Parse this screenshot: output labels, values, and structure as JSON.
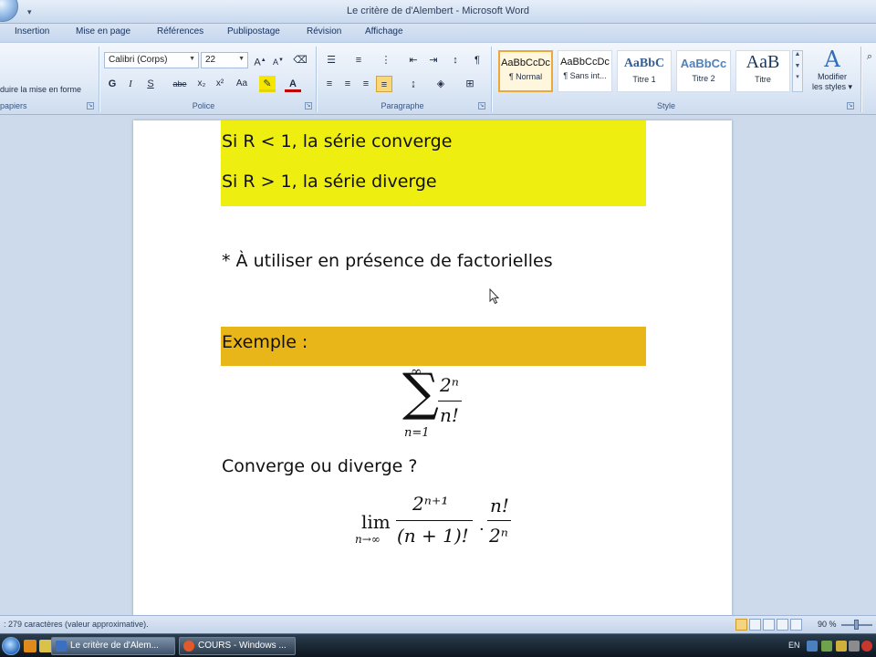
{
  "window": {
    "title": "Le critère de d'Alembert - Microsoft Word"
  },
  "tabs": [
    "Insertion",
    "Mise en page",
    "Références",
    "Publipostage",
    "Révision",
    "Affichage"
  ],
  "ribbon": {
    "clipboard": {
      "reproduce_format": "duire la mise en forme",
      "label": "papiers"
    },
    "font": {
      "name": "Calibri (Corps)",
      "size": "22",
      "label": "Police",
      "buttons": [
        "G",
        "I",
        "S",
        "abe",
        "x₂",
        "x²",
        "Aa"
      ]
    },
    "paragraph": {
      "label": "Paragraphe"
    },
    "styles": {
      "label": "Style",
      "items": [
        {
          "preview": "AaBbCcDc",
          "name": "¶ Normal"
        },
        {
          "preview": "AaBbCcDc",
          "name": "¶ Sans int..."
        },
        {
          "preview": "AaBbC",
          "name": "Titre 1"
        },
        {
          "preview": "AaBbCc",
          "name": "Titre 2"
        },
        {
          "preview": "AaB",
          "name": "Titre"
        }
      ],
      "modify_line1": "Modifier",
      "modify_line2": "les styles"
    }
  },
  "document": {
    "line1": "Si R < 1, la série converge",
    "line2": "Si R > 1, la série diverge",
    "note": "* À utiliser en présence de factorielles",
    "example_label": "Exemple :",
    "question": "Converge ou diverge ?",
    "sum": {
      "upper": "∞",
      "lower": "n=1",
      "numerator": "2ⁿ",
      "denominator": "n!"
    },
    "limit": {
      "lim": "lim",
      "sub": "n→∞",
      "num1": "2ⁿ⁺¹",
      "den1": "(n + 1)!",
      "dot": "·",
      "num2": "n!",
      "den2": "2ⁿ"
    },
    "highlight_yellow": "#eeee11",
    "highlight_orange": "#e9b619"
  },
  "status": {
    "text": ": 279 caractères (valeur approximative).",
    "zoom": "90 %"
  },
  "taskbar": {
    "tasks": [
      {
        "label": "Le critère de d'Alem..."
      },
      {
        "label": "COURS - Windows ..."
      }
    ],
    "lang": "EN"
  }
}
